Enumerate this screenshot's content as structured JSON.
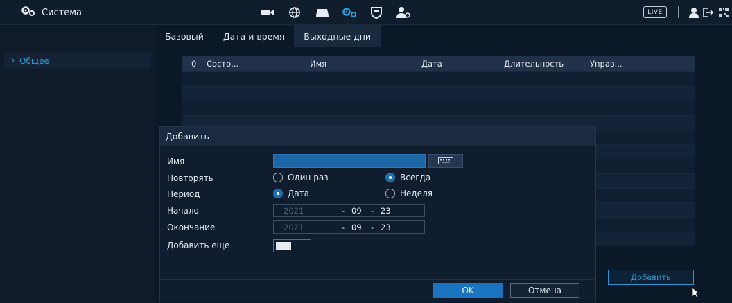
{
  "topbar": {
    "section_title": "Система",
    "icons": [
      "camera-icon",
      "network-icon",
      "storage-icon",
      "settings-icon",
      "shield-icon",
      "account-icon"
    ],
    "live_label": "LIVE"
  },
  "sidebar": {
    "items": [
      {
        "label": "Общее"
      }
    ]
  },
  "tabs": [
    {
      "label": "Базовый"
    },
    {
      "label": "Дата и время"
    },
    {
      "label": "Выходные дни"
    }
  ],
  "table": {
    "columns": [
      "0",
      "Состо...",
      "Имя",
      "Дата",
      "Длительность",
      "Управ..."
    ]
  },
  "add_button_label": "Добавить",
  "dialog": {
    "title": "Добавить",
    "name_label": "Имя",
    "name_value": "",
    "repeat_label": "Повторять",
    "repeat_options": [
      "Один раз",
      "Всегда"
    ],
    "repeat_selected": "Всегда",
    "period_label": "Период",
    "period_options": [
      "Дата",
      "Неделя"
    ],
    "period_selected": "Дата",
    "start_label": "Начало",
    "start": {
      "year": "2021",
      "month": "09",
      "day": "23"
    },
    "end_label": "Окончание",
    "end": {
      "year": "2021",
      "month": "09",
      "day": "23"
    },
    "add_more_label": "Добавить еще",
    "ok_label": "OK",
    "cancel_label": "Отмена"
  },
  "colors": {
    "accent": "#1b74c0",
    "sidebar_active_text": "#2f9bd6"
  }
}
